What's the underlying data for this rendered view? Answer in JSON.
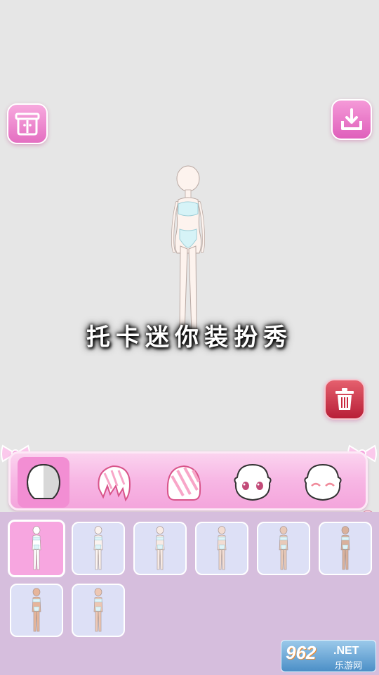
{
  "title": "托卡迷你装扮秀",
  "toolbar": {
    "wardrobe_icon": "wardrobe-icon",
    "save_icon": "download-icon",
    "trash_icon": "trash-icon"
  },
  "tabs": [
    {
      "icon": "body-skin-icon",
      "active": true
    },
    {
      "icon": "hair-front-icon",
      "active": false
    },
    {
      "icon": "hair-back-icon",
      "active": false
    },
    {
      "icon": "face-eyes-icon",
      "active": false
    },
    {
      "icon": "face-closed-eyes-icon",
      "active": false
    }
  ],
  "skin_options": [
    {
      "tone": "#ffffff",
      "selected": true
    },
    {
      "tone": "#fbf3ef",
      "selected": false
    },
    {
      "tone": "#f8ebe5",
      "selected": false
    },
    {
      "tone": "#f2dcd2",
      "selected": false
    },
    {
      "tone": "#e8c9b8",
      "selected": false
    },
    {
      "tone": "#d9b19c",
      "selected": false
    },
    {
      "tone": "#e6b59b",
      "selected": false
    },
    {
      "tone": "#edc7b3",
      "selected": false
    }
  ],
  "watermark": {
    "number": "962",
    "domain": ".NET",
    "site_name": "乐游网"
  },
  "colors": {
    "background": "#e6e6e6",
    "tray": "#d6bedd",
    "accent_pink": "#f28ed3",
    "trash_red": "#c8283f"
  }
}
